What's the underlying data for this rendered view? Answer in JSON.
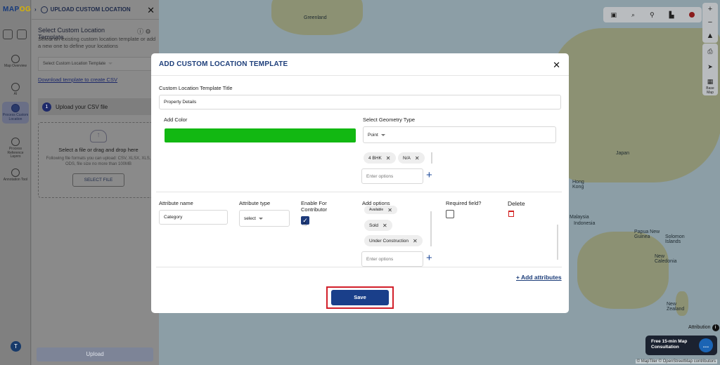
{
  "app": {
    "logo_main": "MAP",
    "logo_accent": "OG",
    "panel_title": "UPLOAD CUSTOM LOCATION",
    "avatar_initial": "T"
  },
  "rail": {
    "items": [
      {
        "label": "Map Overview",
        "icon": "map-icon"
      },
      {
        "label": "AI",
        "icon": "ai-icon"
      },
      {
        "label": "Process Custom Location",
        "icon": "location-pin-icon",
        "active": true
      },
      {
        "label": "Process Reference Layers",
        "icon": "layers-icon"
      },
      {
        "label": "Annotation Tool",
        "icon": "annotation-icon"
      }
    ]
  },
  "panel": {
    "heading": "Select Custom Location Template",
    "description": "Select an existing custom location template or add a new one to define your locations",
    "template_select": "Select Custom Location Template",
    "download_link": "Download template to create CSV",
    "step_number": "1",
    "step_label": "Upload your CSV file",
    "drop_title": "Select a file or drag and drop here",
    "drop_subtitle": "Following file formats you can upload: CSV, XLSX, XLS, ODS, file size no more than 100MB",
    "select_file": "SELECT FILE",
    "upload": "Upload"
  },
  "map": {
    "labels": {
      "greenland": "Greenland",
      "japan": "Japan",
      "hong_kong": "Hong Kong",
      "malaysia": "Malaysia",
      "indonesia": "Indonesia",
      "png": "Papua New Guinea",
      "solomon": "Solomon Islands",
      "new_caledonia": "New Caledonia",
      "new_zealand": "New Zealand"
    },
    "attribution": "Attribution",
    "attribution_footer": "© MapTiler © OpenStreetMap contributors",
    "consult": "Free 15-min Map Consultation",
    "basemap": "Base Map"
  },
  "modal": {
    "title": "ADD CUSTOM LOCATION TEMPLATE",
    "template_title_label": "Custom Location Template Title",
    "template_title_value": "Property Details",
    "add_color_label": "Add Color",
    "color": "#12b812",
    "geometry_label": "Select Geometry Type",
    "geometry_value": "Point",
    "geometry_chips": [
      "4 BHK",
      "N/A"
    ],
    "enter_options_placeholder": "Enter options",
    "columns": {
      "attribute_name": "Attribute name",
      "attribute_type": "Attribute type",
      "enable_contributor": "Enable For Contributor",
      "add_options": "Add options",
      "required": "Required field?",
      "delete": "Delete"
    },
    "row": {
      "name": "Category",
      "type": "select",
      "contributor_checked": true,
      "options": [
        "Available",
        "Sold",
        "Under Construction"
      ],
      "required_checked": false
    },
    "add_attributes": "+ Add attributes",
    "save": "Save"
  }
}
